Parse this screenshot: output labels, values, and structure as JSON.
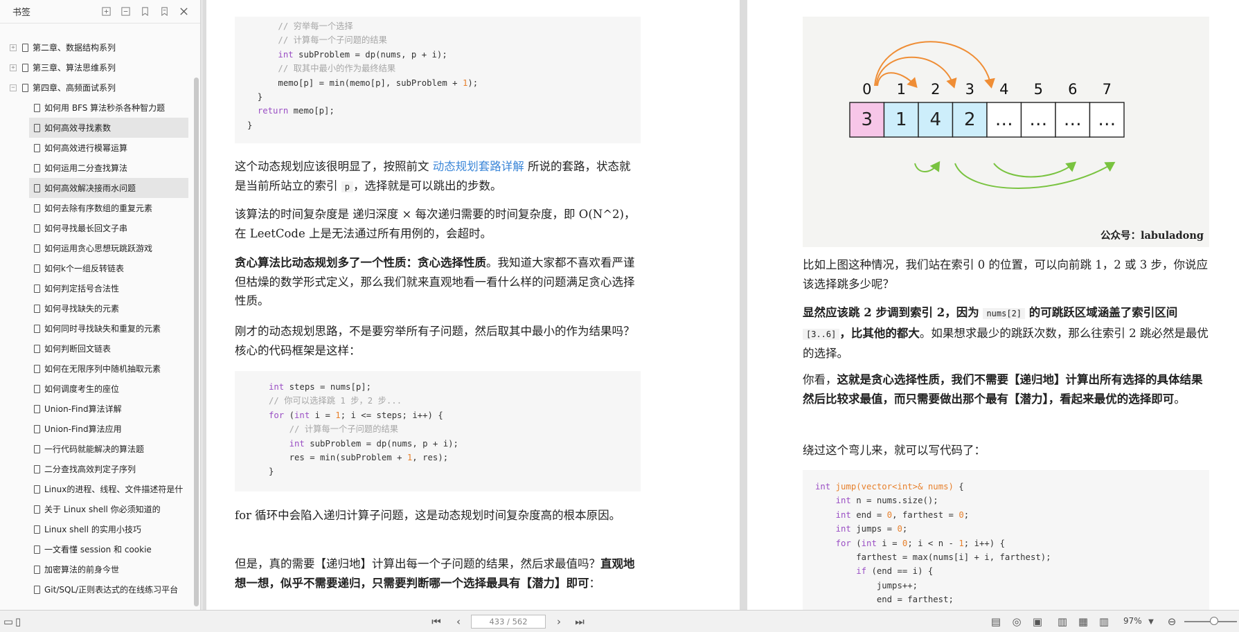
{
  "sidebar": {
    "title": "书签",
    "items": [
      {
        "label": "第二章、数据结构系列",
        "level": 0,
        "toggle": "+"
      },
      {
        "label": "第三章、算法思维系列",
        "level": 0,
        "toggle": "+"
      },
      {
        "label": "第四章、高频面试系列",
        "level": 0,
        "toggle": "−"
      },
      {
        "label": "如何用 BFS 算法秒杀各种智力题",
        "level": 1
      },
      {
        "label": "如何高效寻找素数",
        "level": 1,
        "selected": true
      },
      {
        "label": "如何高效进行模幂运算",
        "level": 1
      },
      {
        "label": "如何运用二分查找算法",
        "level": 1
      },
      {
        "label": "如何高效解决接雨水问题",
        "level": 1,
        "selected": true
      },
      {
        "label": "如何去除有序数组的重复元素",
        "level": 1
      },
      {
        "label": "如何寻找最长回文子串",
        "level": 1
      },
      {
        "label": "如何运用贪心思想玩跳跃游戏",
        "level": 1
      },
      {
        "label": "如何k个一组反转链表",
        "level": 1
      },
      {
        "label": "如何判定括号合法性",
        "level": 1
      },
      {
        "label": "如何寻找缺失的元素",
        "level": 1
      },
      {
        "label": "如何同时寻找缺失和重复的元素",
        "level": 1
      },
      {
        "label": "如何判断回文链表",
        "level": 1
      },
      {
        "label": "如何在无限序列中随机抽取元素",
        "level": 1
      },
      {
        "label": "如何调度考生的座位",
        "level": 1
      },
      {
        "label": "Union-Find算法详解",
        "level": 1
      },
      {
        "label": "Union-Find算法应用",
        "level": 1
      },
      {
        "label": "一行代码就能解决的算法题",
        "level": 1
      },
      {
        "label": "二分查找高效判定子序列",
        "level": 1
      },
      {
        "label": "Linux的进程、线程、文件描述符是什",
        "level": 1
      },
      {
        "label": "关于 Linux shell 你必须知道的",
        "level": 1
      },
      {
        "label": "Linux shell 的实用小技巧",
        "level": 1
      },
      {
        "label": "一文看懂 session 和 cookie",
        "level": 1
      },
      {
        "label": "加密算法的前身今世",
        "level": 1
      },
      {
        "label": "Git/SQL/正则表达式的在线练习平台",
        "level": 1
      }
    ]
  },
  "left_page": {
    "code1": [
      "      // 穷举每一个选择",
      "      // 计算每一个子问题的结果",
      "      int subProblem = dp(nums, p + i);",
      "      // 取其中最小的作为最终结果",
      "      memo[p] = min(memo[p], subProblem + 1);",
      "  }",
      "  return memo[p];",
      "}"
    ],
    "p1_a": "这个动态规划应该很明显了，按照前文 ",
    "p1_link": "动态规划套路详解",
    "p1_b": " 所说的套路，状态就是当前所站立的索引 ",
    "p1_code": "p",
    "p1_c": "，选择就是可以跳出的步数。",
    "p2": "该算法的时间复杂度是 递归深度 × 每次递归需要的时间复杂度，即 O(N^2)，在 LeetCode 上是无法通过所有用例的，会超时。",
    "p3_bold": "贪心算法比动态规划多了一个性质：贪心选择性质",
    "p3_rest": "。我知道大家都不喜欢看严谨但枯燥的数学形式定义，那么我们就来直观地看一看什么样的问题满足贪心选择性质。",
    "p4": "刚才的动态规划思路，不是要穷举所有子问题，然后取其中最小的作为结果吗？核心的代码框架是这样：",
    "code2": [
      "int steps = nums[p];",
      "// 你可以选择跳 1 步，2 步...",
      "for (int i = 1; i <= steps; i++) {",
      "    // 计算每一个子问题的结果",
      "    int subProblem = dp(nums, p + i);",
      "    res = min(subProblem + 1, res);",
      "}"
    ],
    "p5": "for 循环中会陷入递归计算子问题，这是动态规划时间复杂度高的根本原因。",
    "p6_a": "但是，真的需要【递归地】计算出每一个子问题的结果，然后求最值吗？",
    "p6_bold": "直观地想一想，似乎不需要递归，只需要判断哪一个选择最具有【潜力】即可",
    "p6_c": "："
  },
  "right_page": {
    "figure": {
      "indices": [
        "0",
        "1",
        "2",
        "3",
        "4",
        "5",
        "6",
        "7"
      ],
      "cells": [
        "3",
        "1",
        "4",
        "2",
        "…",
        "…",
        "…",
        "…"
      ],
      "caption": "公众号：labuladong",
      "colors": {
        "first": "#f7c6e8",
        "blue": "#cdeefb",
        "orange": "#ef8d35",
        "green": "#79c340"
      }
    },
    "p1": "比如上图这种情况，我们站在索引 0 的位置，可以向前跳 1，2 或 3 步，你说应该选择跳多少呢？",
    "p2_bold_a": "显然应该跳 2 步调到索引 2，因为 ",
    "p2_code1": "nums[2]",
    "p2_bold_b": " 的可跳跃区域涵盖了索引区间 ",
    "p2_code2": "[3..6]",
    "p2_bold_c": "，比其他的都大",
    "p2_rest": "。如果想求最少的跳跃次数，那么往索引 2 跳必然是最优的选择。",
    "p3_a": "你看，",
    "p3_bold": "这就是贪心选择性质，我们不需要【递归地】计算出所有选择的具体结果然后比较求最值，而只需要做出那个最有【潜力】，看起来最优的选择即可",
    "p3_c": "。",
    "p4": "绕过这个弯儿来，就可以写代码了："
  },
  "status_bar": {
    "page_indicator": "433 / 562",
    "zoom": "97%"
  }
}
